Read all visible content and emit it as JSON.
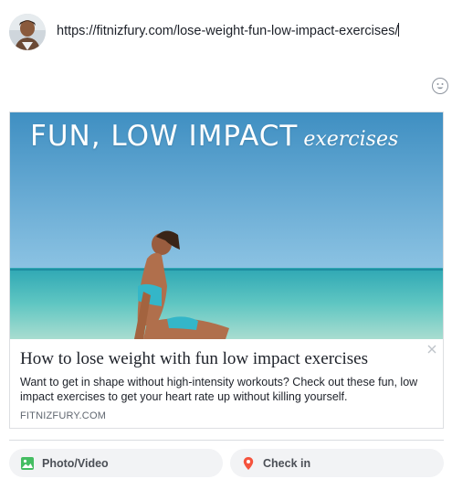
{
  "composer": {
    "text": "https://fitnizfury.com/lose-weight-fun-low-impact-exercises/",
    "avatar_icon": "user-avatar",
    "emoji_icon": "smiley-face-icon"
  },
  "link_preview": {
    "image_headline_main": "FUN, LOW IMPACT",
    "image_headline_script": "exercises",
    "title": "How to lose weight with fun low impact exercises",
    "description": "Want to get in shape without high-intensity workouts? Check out these fun, low impact exercises to get your heart rate up without killing yourself.",
    "domain": "FITNIZFURY.COM",
    "close_icon": "close-icon"
  },
  "actions": [
    {
      "label": "Photo/Video",
      "icon": "photo-icon",
      "color": "#45bd62"
    },
    {
      "label": "Check in",
      "icon": "location-pin-icon",
      "color": "#f5533d"
    }
  ]
}
